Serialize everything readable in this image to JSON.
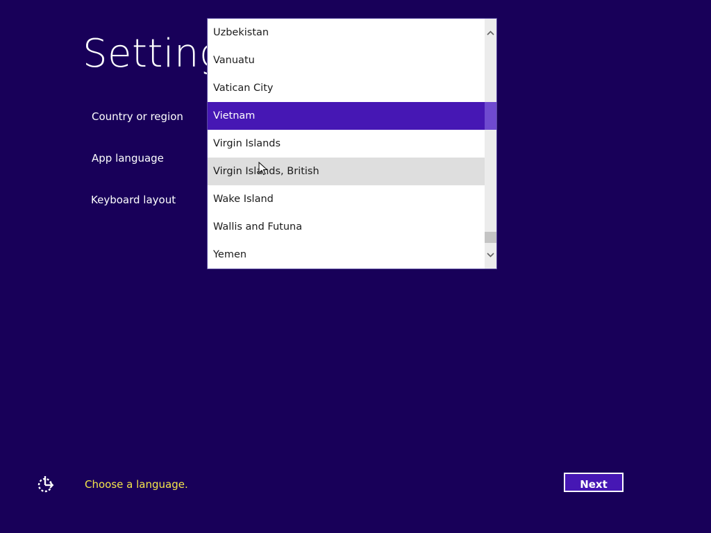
{
  "page": {
    "title": "Settings"
  },
  "fields": {
    "country_label": "Country or region",
    "app_language_label": "App language",
    "keyboard_layout_label": "Keyboard layout"
  },
  "dropdown": {
    "items": [
      "Uzbekistan",
      "Vanuatu",
      "Vatican City",
      "Vietnam",
      "Virgin Islands",
      "Virgin Islands, British",
      "Wake Island",
      "Wallis and Futuna",
      "Yemen"
    ],
    "selected": "Vietnam",
    "hovered": "Virgin Islands, British"
  },
  "footer": {
    "hint": "Choose a language.",
    "next_label": "Next"
  },
  "colors": {
    "background": "#180059",
    "accent": "#4617b4",
    "hint": "#f5e64a"
  },
  "icons": {
    "ease_of_access": "ease-of-access-icon",
    "scroll_up": "chevron-up-icon",
    "scroll_down": "chevron-down-icon"
  }
}
